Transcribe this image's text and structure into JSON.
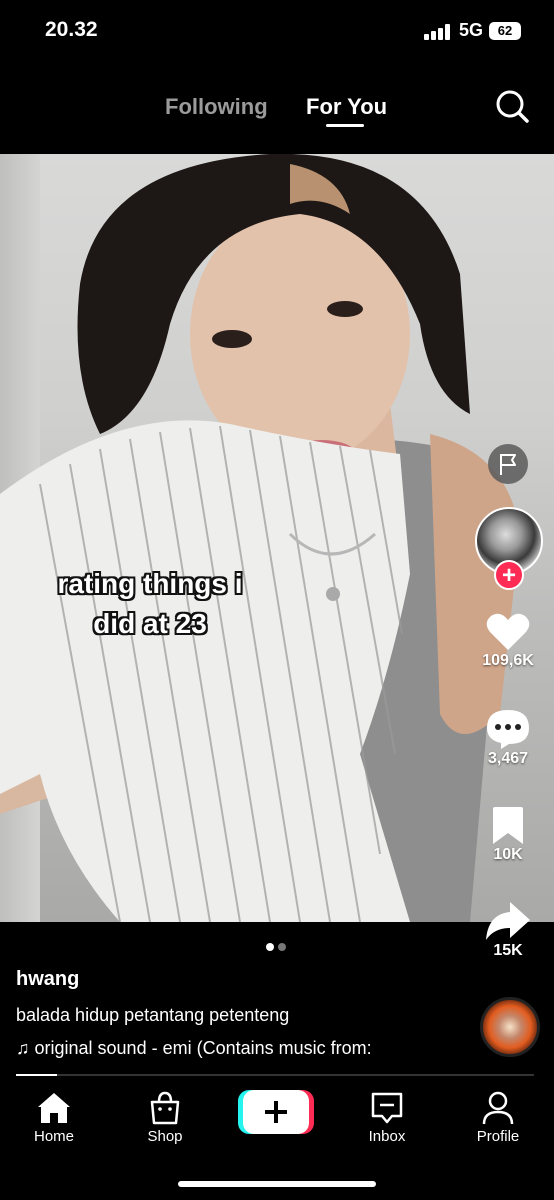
{
  "status_bar": {
    "time": "20.32",
    "network": "5G",
    "battery": "62"
  },
  "top_nav": {
    "following_label": "Following",
    "foryou_label": "For You"
  },
  "video": {
    "overlay_text_line1": "rating things i",
    "overlay_text_line2": "did at 23"
  },
  "actions": {
    "likes": "109,6K",
    "comments": "3,467",
    "saves": "10K",
    "shares": "15K"
  },
  "post": {
    "username": "hwang",
    "description": "balada hidup petantang petenteng",
    "sound": "♫ original sound - emi (Contains music from:",
    "progress_percent": 8
  },
  "page_dots": {
    "active": 1,
    "total": 2
  },
  "bottom_nav": {
    "home": "Home",
    "shop": "Shop",
    "inbox": "Inbox",
    "profile": "Profile"
  },
  "colors": {
    "accent": "#fe2c55",
    "cyan": "#25f4ee",
    "inactive_tab": "#9b9b9b"
  },
  "icons": [
    "search-icon",
    "flag-icon",
    "heart-icon",
    "comment-icon",
    "bookmark-icon",
    "share-icon",
    "home-icon",
    "shop-icon",
    "create-icon",
    "inbox-icon",
    "profile-icon"
  ]
}
